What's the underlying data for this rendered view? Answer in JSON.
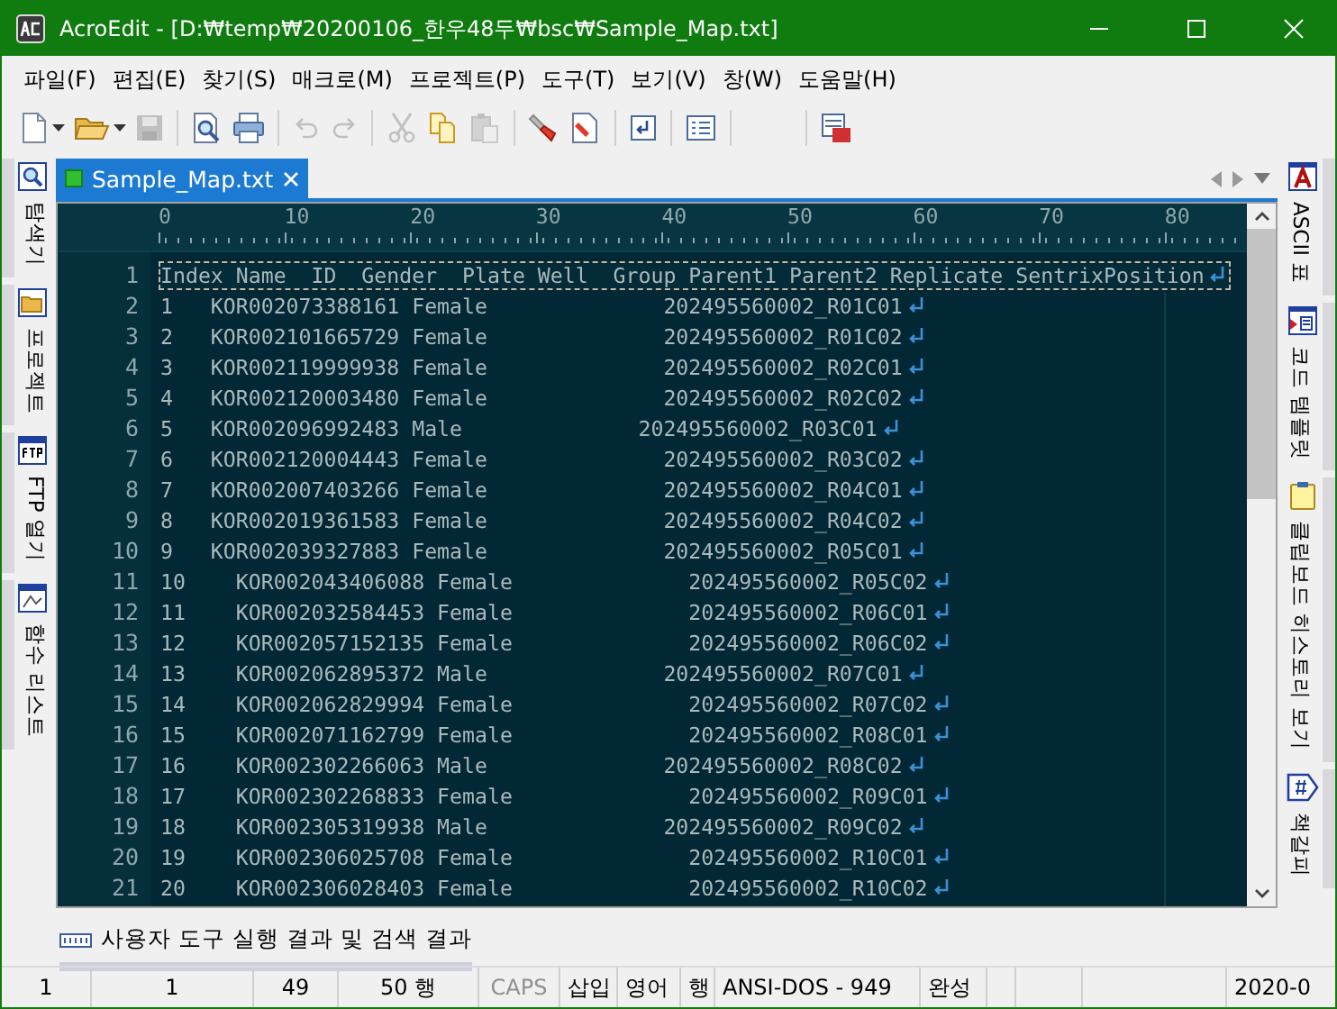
{
  "window": {
    "title": "AcroEdit - [D:₩temp₩20200106_한우48두₩bsc₩Sample_Map.txt]"
  },
  "menu": [
    "파일(F)",
    "편집(E)",
    "찾기(S)",
    "매크로(M)",
    "프로젝트(P)",
    "도구(T)",
    "보기(V)",
    "창(W)",
    "도움말(H)"
  ],
  "toolbar": [
    {
      "kind": "new",
      "disabled": false
    },
    {
      "kind": "open",
      "disabled": false
    },
    {
      "kind": "save",
      "disabled": true
    },
    {
      "kind": "sep"
    },
    {
      "kind": "preview",
      "disabled": false
    },
    {
      "kind": "print",
      "disabled": false
    },
    {
      "kind": "sep"
    },
    {
      "kind": "undo",
      "disabled": true
    },
    {
      "kind": "redo",
      "disabled": true
    },
    {
      "kind": "sep"
    },
    {
      "kind": "cut",
      "disabled": true
    },
    {
      "kind": "copy",
      "disabled": false
    },
    {
      "kind": "paste",
      "disabled": true
    },
    {
      "kind": "sep"
    },
    {
      "kind": "marker",
      "disabled": false
    },
    {
      "kind": "unmark",
      "disabled": false
    },
    {
      "kind": "sep"
    },
    {
      "kind": "page",
      "disabled": false
    },
    {
      "kind": "sep"
    },
    {
      "kind": "list",
      "disabled": false
    },
    {
      "kind": "sep"
    },
    {
      "kind": "sep"
    },
    {
      "kind": "calendar",
      "disabled": false
    }
  ],
  "left_panels": [
    {
      "kind": "search",
      "label": "탐색기"
    },
    {
      "kind": "folder",
      "label": "프로젝트"
    },
    {
      "kind": "ftp",
      "label": "FTP 열기"
    },
    {
      "kind": "func",
      "label": "함수 리스트"
    }
  ],
  "right_panels": [
    {
      "kind": "ascii",
      "label": "ASCII 표"
    },
    {
      "kind": "template",
      "label": "코드 템플릿"
    },
    {
      "kind": "clipboard",
      "label": "클립보드 히스토리 보기"
    },
    {
      "kind": "bookmark",
      "label": "책갈피"
    }
  ],
  "tabs": [
    {
      "label": "Sample_Map.txt",
      "selected": true
    }
  ],
  "editor": {
    "ruler": [
      "0",
      "10",
      "20",
      "30",
      "40",
      "50",
      "60",
      "70",
      "80"
    ],
    "lines": [
      {
        "number": "1",
        "text": "Index Name  ID  Gender  Plate Well  Group Parent1 Parent2 Replicate SentrixPosition",
        "current": true
      },
      {
        "number": "2",
        "text": "1   KOR002073388161 Female              202495560002_R01C01",
        "current": false
      },
      {
        "number": "3",
        "text": "2   KOR002101665729 Female              202495560002_R01C02",
        "current": false
      },
      {
        "number": "4",
        "text": "3   KOR002119999938 Female              202495560002_R02C01",
        "current": false
      },
      {
        "number": "5",
        "text": "4   KOR002120003480 Female              202495560002_R02C02",
        "current": false
      },
      {
        "number": "6",
        "text": "5   KOR002096992483 Male              202495560002_R03C01",
        "current": false
      },
      {
        "number": "7",
        "text": "6   KOR002120004443 Female              202495560002_R03C02",
        "current": false
      },
      {
        "number": "8",
        "text": "7   KOR002007403266 Female              202495560002_R04C01",
        "current": false
      },
      {
        "number": "9",
        "text": "8   KOR002019361583 Female              202495560002_R04C02",
        "current": false
      },
      {
        "number": "10",
        "text": "9   KOR002039327883 Female              202495560002_R05C01",
        "current": false
      },
      {
        "number": "11",
        "text": "10    KOR002043406088 Female              202495560002_R05C02",
        "current": false
      },
      {
        "number": "12",
        "text": "11    KOR002032584453 Female              202495560002_R06C01",
        "current": false
      },
      {
        "number": "13",
        "text": "12    KOR002057152135 Female              202495560002_R06C02",
        "current": false
      },
      {
        "number": "14",
        "text": "13    KOR002062895372 Male              202495560002_R07C01",
        "current": false
      },
      {
        "number": "15",
        "text": "14    KOR002062829994 Female              202495560002_R07C02",
        "current": false
      },
      {
        "number": "16",
        "text": "15    KOR002071162799 Female              202495560002_R08C01",
        "current": false
      },
      {
        "number": "17",
        "text": "16    KOR002302266063 Male              202495560002_R08C02",
        "current": false
      },
      {
        "number": "18",
        "text": "17    KOR002302268833 Female              202495560002_R09C01",
        "current": false
      },
      {
        "number": "19",
        "text": "18    KOR002305319938 Male              202495560002_R09C02",
        "current": false
      },
      {
        "number": "20",
        "text": "19    KOR002306025708 Female              202495560002_R10C01",
        "current": false
      },
      {
        "number": "21",
        "text": "20    KOR002306028403 Female              202495560002_R10C02",
        "current": false
      }
    ]
  },
  "output_tab": {
    "label": "사용자 도구 실행 결과 및 검색 결과"
  },
  "status_bar": [
    {
      "text": "1",
      "disabled": false
    },
    {
      "text": "1",
      "disabled": false
    },
    {
      "text": "49",
      "disabled": false
    },
    {
      "text": "50 행",
      "disabled": false
    },
    {
      "text": "CAPS",
      "disabled": true
    },
    {
      "text": "삽입",
      "disabled": false
    },
    {
      "text": "영어",
      "disabled": false
    },
    {
      "text": "행",
      "disabled": false
    },
    {
      "text": "ANSI-DOS - 949",
      "disabled": false
    },
    {
      "text": "완성",
      "disabled": false
    },
    {
      "text": "2020-0",
      "disabled": false
    }
  ]
}
